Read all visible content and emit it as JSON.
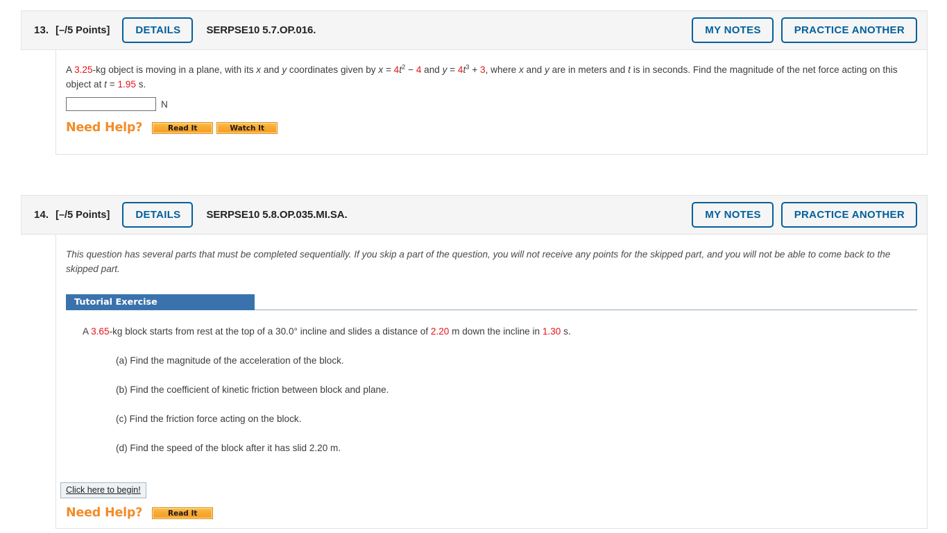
{
  "questions": [
    {
      "number": "13.",
      "points": "[–/5 Points]",
      "details_label": "DETAILS",
      "code": "SERPSE10 5.7.OP.016.",
      "my_notes_label": "MY NOTES",
      "practice_another_label": "PRACTICE ANOTHER",
      "problem": {
        "t1": "A ",
        "mass": "3.25",
        "t2": "-kg object is moving in a plane, with its ",
        "var_x": "x",
        "t3": " and ",
        "var_y": "y",
        "t4": " coordinates given by ",
        "eq_x_lhs": "x",
        "eq_x_eq": " = ",
        "eq_x_c1": "4",
        "eq_x_t": "t",
        "eq_x_p1": "2",
        "eq_x_minus": " − ",
        "eq_x_c2": "4",
        "t5": " and ",
        "eq_y_lhs": "y",
        "eq_y_eq": " = ",
        "eq_y_c1": "4",
        "eq_y_t": "t",
        "eq_y_p1": "3",
        "eq_y_plus": " + ",
        "eq_y_c2": "3",
        "t6": ", where ",
        "t7": " and ",
        "t8": " are in meters and ",
        "var_t": "t",
        "t9": " is in seconds. Find the magnitude of the net force acting on this object at ",
        "at_t": "t",
        "at_eq": " = ",
        "time": "1.95",
        "t10": " s."
      },
      "answer_value": "",
      "answer_unit": "N",
      "need_help_label": "Need Help?",
      "help_buttons": [
        "Read It",
        "Watch It"
      ]
    },
    {
      "number": "14.",
      "points": "[–/5 Points]",
      "details_label": "DETAILS",
      "code": "SERPSE10 5.8.OP.035.MI.SA.",
      "my_notes_label": "MY NOTES",
      "practice_another_label": "PRACTICE ANOTHER",
      "sequential_notice": "This question has several parts that must be completed sequentially. If you skip a part of the question, you will not receive any points for the skipped part, and you will not be able to come back to the skipped part.",
      "tutorial_banner": "Tutorial Exercise",
      "problem": {
        "t1": "A ",
        "mass": "3.65",
        "t2": "-kg block starts from rest at the top of a 30.0° incline and slides a distance of ",
        "distance": "2.20",
        "t3": " m down the incline in ",
        "time": "1.30",
        "t4": " s."
      },
      "subparts": [
        "(a) Find the magnitude of the acceleration of the block.",
        "(b) Find the coefficient of kinetic friction between block and plane.",
        "(c) Find the friction force acting on the block.",
        "(d) Find the speed of the block after it has slid 2.20 m."
      ],
      "begin_label": "Click here to begin!",
      "need_help_label": "Need Help?",
      "help_buttons": [
        "Read It"
      ]
    }
  ],
  "colors": {
    "accent_blue": "#00609c",
    "banner_blue": "#3a72ad",
    "value_red": "#e8121a",
    "help_orange": "#f28c28"
  }
}
